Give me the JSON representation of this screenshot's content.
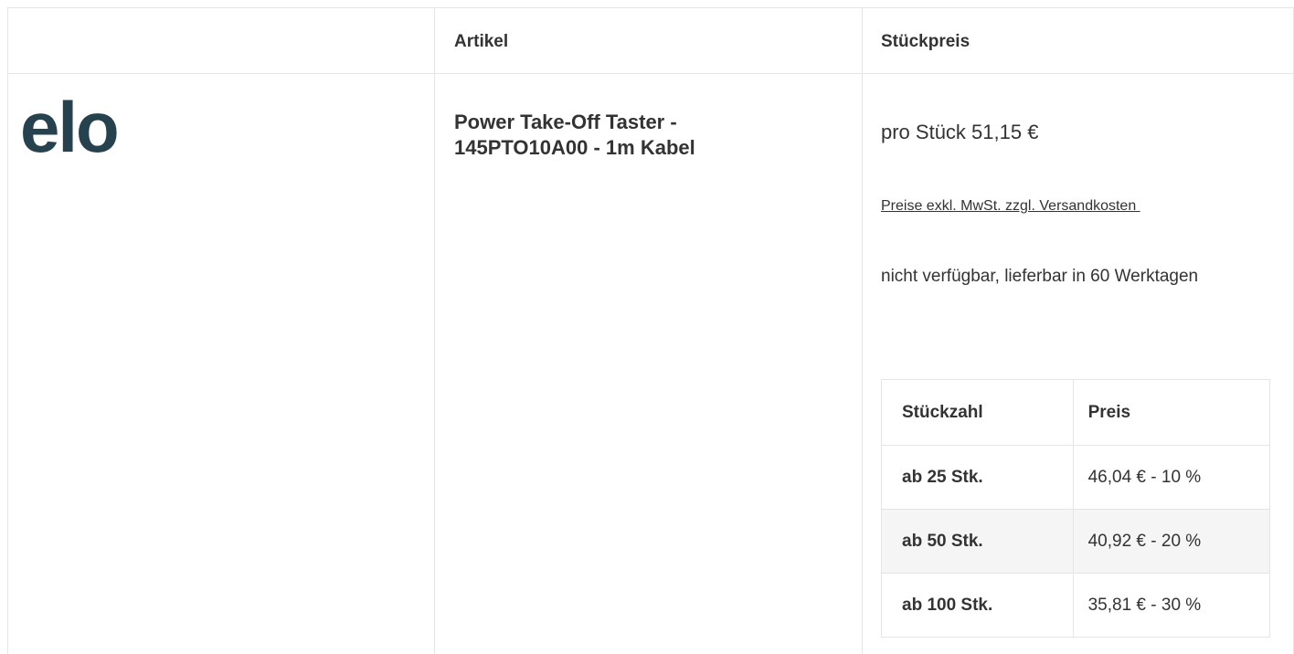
{
  "header": {
    "col_article": "Artikel",
    "col_unit_price": "Stückpreis"
  },
  "brand": {
    "logo_text": "elo",
    "color": "#27424f"
  },
  "product": {
    "name_line1": "Power Take-Off Taster -",
    "name_line2": "145PTO10A00 - 1m Kabel"
  },
  "pricing": {
    "unit_price": "pro Stück 51,15 €",
    "tax_note": "Preise exkl. MwSt. zzgl. Versandkosten ",
    "availability": "nicht verfügbar, lieferbar in 60 Werktagen"
  },
  "tier_table": {
    "headers": [
      "Stückzahl",
      "Preis"
    ],
    "rows": [
      {
        "qty": "ab 25 Stk.",
        "price": "46,04 € - 10 %"
      },
      {
        "qty": "ab 50 Stk.",
        "price": "40,92 € - 20 %"
      },
      {
        "qty": "ab 100 Stk.",
        "price": "35,81 € - 30 %"
      }
    ]
  }
}
